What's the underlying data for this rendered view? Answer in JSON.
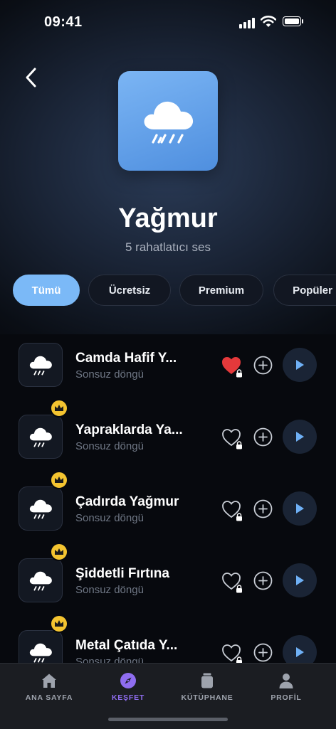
{
  "status_bar": {
    "time": "09:41",
    "icons": [
      "signal-icon",
      "wifi-icon",
      "battery-icon"
    ]
  },
  "header": {
    "back_icon": "chevron-left-icon",
    "art_icon": "rain-cloud-icon",
    "title": "Yağmur",
    "subtitle": "5 rahatlatıcı ses"
  },
  "filters": {
    "items": [
      {
        "label": "Tümü",
        "active": true
      },
      {
        "label": "Ücretsiz",
        "active": false
      },
      {
        "label": "Premium",
        "active": false
      },
      {
        "label": "Popüler",
        "active": false
      }
    ]
  },
  "sounds": [
    {
      "title": "Camda Hafif Y...",
      "subtitle": "Sonsuz döngü",
      "premium": false,
      "favorite": true,
      "locked": true
    },
    {
      "title": "Yapraklarda Ya...",
      "subtitle": "Sonsuz döngü",
      "premium": true,
      "favorite": false,
      "locked": true
    },
    {
      "title": "Çadırda Yağmur",
      "subtitle": "Sonsuz döngü",
      "premium": true,
      "favorite": false,
      "locked": true
    },
    {
      "title": "Şiddetli Fırtına",
      "subtitle": "Sonsuz döngü",
      "premium": true,
      "favorite": false,
      "locked": true
    },
    {
      "title": "Metal Çatıda Y...",
      "subtitle": "Sonsuz döngü",
      "premium": true,
      "favorite": false,
      "locked": true
    }
  ],
  "tabbar": {
    "items": [
      {
        "label": "ANA SAYFA",
        "icon": "home-icon",
        "active": false
      },
      {
        "label": "KEŞFET",
        "icon": "compass-icon",
        "active": true
      },
      {
        "label": "KÜTÜPHANE",
        "icon": "library-icon",
        "active": false
      },
      {
        "label": "PROFİL",
        "icon": "profile-icon",
        "active": false
      }
    ]
  },
  "colors": {
    "accent": "#7bb9f7",
    "active_tab": "#8f6df0",
    "favorite": "#e5393b",
    "crown": "#f4c430",
    "play_bg": "#1a2435"
  }
}
